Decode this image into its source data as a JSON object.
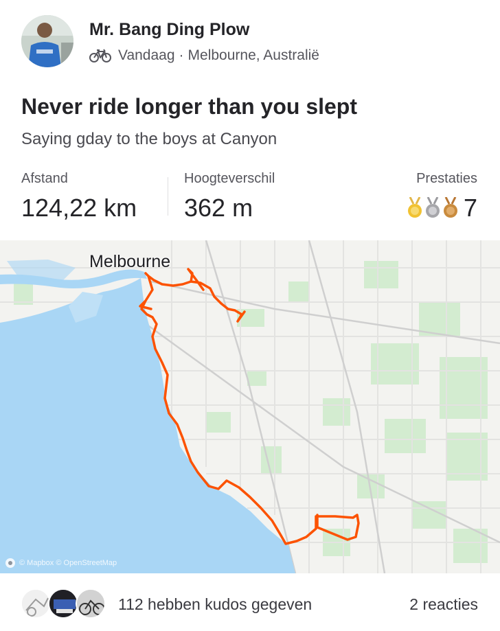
{
  "activity": {
    "athlete_name": "Mr. Bang Ding Plow",
    "sport_icon": "bike-icon",
    "date": "Vandaag",
    "separator": "·",
    "location": "Melbourne, Australië",
    "title": "Never ride longer than you slept",
    "description": "Saying gday to the boys at Canyon"
  },
  "stats": {
    "distance_label": "Afstand",
    "distance_value": "124,22 km",
    "elevation_label": "Hoogteverschil",
    "elevation_value": "362 m",
    "achievements_label": "Prestaties",
    "achievements_count": "7",
    "medal_icons": [
      "gold-medal-icon",
      "silver-medal-icon",
      "bronze-medal-icon"
    ]
  },
  "map": {
    "city_label": "Melbourne",
    "attribution": "© Mapbox © OpenStreetMap",
    "route_color": "#fc5200",
    "water_color": "#a9d6f5",
    "land_color": "#f3f3f0",
    "park_color": "#d3ecd0"
  },
  "social": {
    "kudos_text": "112 hebben kudos gegeven",
    "comments_text": "2 reacties"
  }
}
